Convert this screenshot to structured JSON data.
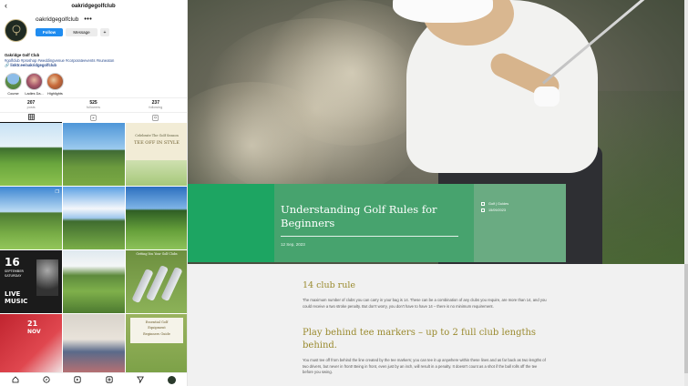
{
  "instagram": {
    "username": "oakridgegolfclub",
    "header_username": "oakridgegolfclub",
    "more": "•••",
    "follow_label": "Follow",
    "message_label": "Message",
    "adduser_label": "+",
    "bio_name": "Oakridge Golf Club",
    "bio_tags": "#golfclub #proshop #weddingvenue #corporateevents #nuneaton",
    "bio_link": "linktr.ee/oakridgegolfclub",
    "highlights": [
      {
        "label": "Course",
        "color": "#5f8f4a"
      },
      {
        "label": "Ladies Da...",
        "color": "#a7566a"
      },
      {
        "label": "Highlights",
        "color": "#c86a3a"
      }
    ],
    "stats": [
      {
        "count": "207",
        "label": "posts"
      },
      {
        "count": "525",
        "label": "followers"
      },
      {
        "count": "237",
        "label": "following"
      }
    ],
    "tabs": [
      "grid-icon",
      "reels-icon",
      "tagged-icon"
    ],
    "grid_text": {
      "cell3_line1": "Celebrate The Golf Season",
      "cell3_line2": "TEE OFF IN STYLE",
      "cell7_line1": "16",
      "cell7_line2": "SEPTEMBER",
      "cell7_line3": "SATURDAY",
      "cell7_line4": "LIVE",
      "cell7_line5": "MUSIC",
      "cell9_line1": "Getting You Your Golf Clubs",
      "cell10_line1": "21",
      "cell10_line2": "NOV",
      "cell12_line1": "Essential Golf",
      "cell12_line2": "Equipment",
      "cell12_line3": "Beginners Guide"
    },
    "nav": [
      "home-icon",
      "explore-icon",
      "reels-icon",
      "add-icon",
      "send-icon",
      "profile-icon"
    ]
  },
  "site": {
    "title": "Understanding Golf Rules for Beginners",
    "date": "12 Sep, 2023",
    "category": "Golf | Guides",
    "meta_date": "15/09/2023",
    "section1_heading": "14 club rule",
    "section1_text": "The maximum number of clubs you can carry in your bag is 14. These can be a combination of any clubs you require, are more than 14, and you could receive a two stroke penalty. But don't worry, you don't have to have 14 – there is no minimum requirement.",
    "section2_heading": "Play behind tee markers – up to 2 full club lengths behind.",
    "section2_text": "You must tee off from behind the line created by the tee markers; you can tee it up anywhere within these lines and as far back as two lengths of two drivers, but never in front! Being in front, even just by an inch, will result in a penalty. It doesn't count as a shot if the ball rolls off the tee before you swing."
  },
  "colors": {
    "follow": "#1f8cf0",
    "card_green": "#1da562",
    "card_main": "#47a36e",
    "card_right": "#6aab82",
    "heading_gold": "#9a8a2e"
  }
}
